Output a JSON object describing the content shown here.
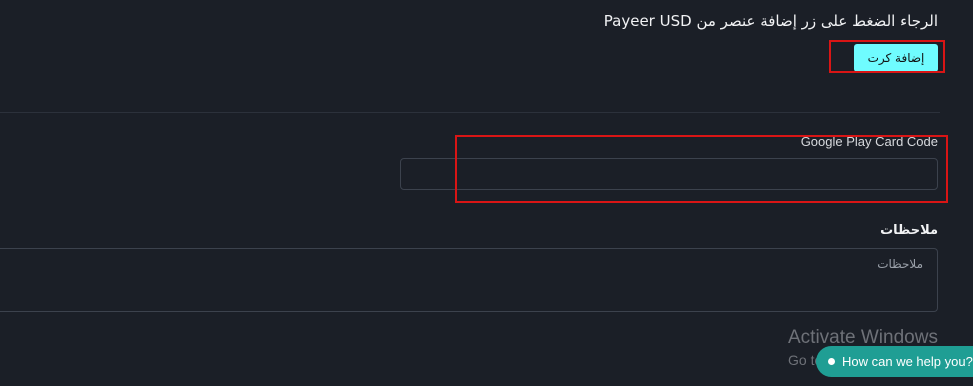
{
  "instruction": {
    "text": "الرجاء الضغط على زر إضافة عنصر من Payeer USD"
  },
  "add_card": {
    "label": "إضافة كرت"
  },
  "card_code": {
    "label": "Google Play Card Code",
    "value": ""
  },
  "notes": {
    "label": "ملاحظات",
    "placeholder": "ملاحظات",
    "value": ""
  },
  "windows_watermark": {
    "title": "Activate Windows",
    "subtitle": "Go to"
  },
  "chat_widget": {
    "label": "How can we help you?",
    "icon": "chat-status-dot"
  },
  "colors": {
    "background": "#1b1f27",
    "accent_button": "#6ffcff",
    "highlight": "#d91515",
    "chat": "#1f9e94"
  }
}
